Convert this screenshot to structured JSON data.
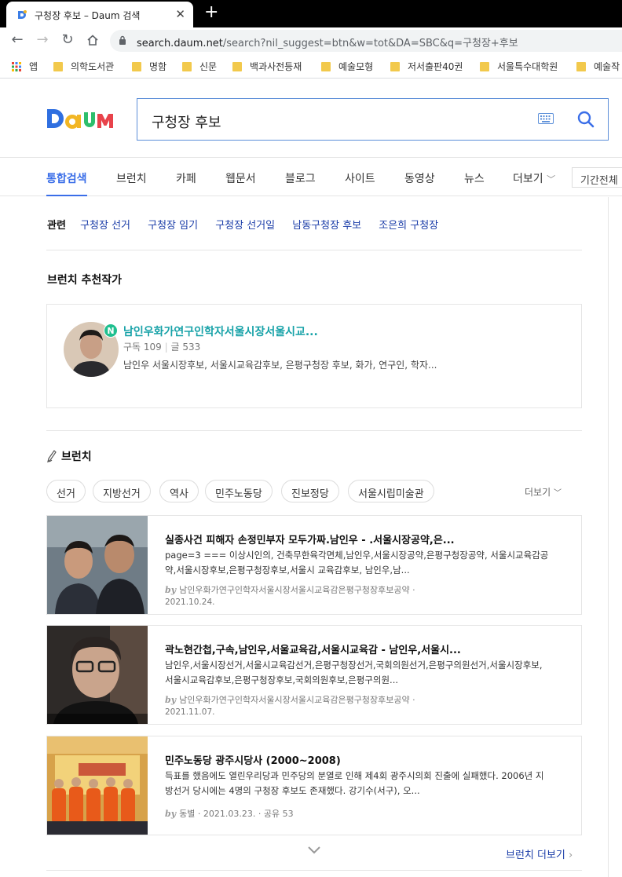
{
  "browser": {
    "tab_title": "구청장 후보 – Daum 검색",
    "url_host": "search.daum.net",
    "url_rest": "/search?nil_suggest=btn&w=tot&DA=SBC&q=구청장+후보",
    "bookmarks": [
      {
        "label": "앱",
        "kind": "apps"
      },
      {
        "label": "의학도서관",
        "kind": "folder"
      },
      {
        "label": "명함",
        "kind": "folder"
      },
      {
        "label": "신문",
        "kind": "folder"
      },
      {
        "label": "백과사전등재",
        "kind": "folder"
      },
      {
        "label": "예술모형",
        "kind": "folder"
      },
      {
        "label": "저서출판40권",
        "kind": "folder"
      },
      {
        "label": "서울특수대학원",
        "kind": "folder"
      },
      {
        "label": "예술작",
        "kind": "folder"
      }
    ]
  },
  "search": {
    "query": "구청장 후보"
  },
  "gnb": {
    "items": [
      "통합검색",
      "브런치",
      "카페",
      "웹문서",
      "블로그",
      "사이트",
      "동영상",
      "뉴스",
      "더보기"
    ],
    "period": "기간전체"
  },
  "related": {
    "label": "관련",
    "keywords": [
      "구청장 선거",
      "구청장 임기",
      "구청장 선거일",
      "남동구청장 후보",
      "조은희 구청장"
    ]
  },
  "author_section": {
    "title": "브런치 추천작가",
    "badge": "N",
    "name": "남인우화가연구인학자서울시장서울시교...",
    "subs": "구독 109",
    "posts": "글 533",
    "desc": "남인우 서울시장후보, 서울시교육감후보, 은평구청장 후보, 화가, 연구인, 학자..."
  },
  "brunch": {
    "title": "브런치",
    "chips": [
      "선거",
      "지방선거",
      "역사",
      "민주노동당",
      "진보정당",
      "서울시립미술관"
    ],
    "more": "더보기",
    "posts": [
      {
        "title": "실종사건 피해자 손정민부자 모두가짜.남인우 - .서울시장공약,은...",
        "desc": "page=3 === 이상시인의, 건축무한육각면체,남인우,서울시장공약,은평구청장공약, 서울시교육감공약,서울시장후보,은평구청장후보,서울시 교육감후보, 남인우,남...",
        "by": "by",
        "author": "남인우화가연구인학자서울시장서울시교육감은평구청장후보공약",
        "date": "2021.10.24."
      },
      {
        "title": "곽노현간첩,구속,남인우,서울교육감,서울시교육감 - 남인우,서울시...",
        "desc": "남인우,서울시장선거,서울시교육감선거,은평구청장선거,국회의원선거,은평구의원선거,서울시장후보,서울시교육감후보,은평구청장후보,국회의원후보,은평구의원...",
        "by": "by",
        "author": "남인우화가연구인학자서울시장서울시교육감은평구청장후보공약",
        "date": "2021.11.07."
      },
      {
        "title": "민주노동당 광주시당사 (2000~2008)",
        "desc": "득표를 했음에도 열린우리당과 민주당의 분열로 인해 제4회 광주시의회 진출에 실패했다. 2006년 지방선거 당시에는 4명의 구청장 후보도 존재했다. 강기수(서구), 오...",
        "by": "by",
        "author": "동별",
        "date": "2021.03.23.",
        "share": "공유 53"
      }
    ],
    "more_link": "브런치 더보기"
  },
  "colors": {
    "accent": "#3a6ee8",
    "link": "#1a3ca8",
    "author_name": "#17a2a8",
    "badge": "#1fbf8f"
  }
}
